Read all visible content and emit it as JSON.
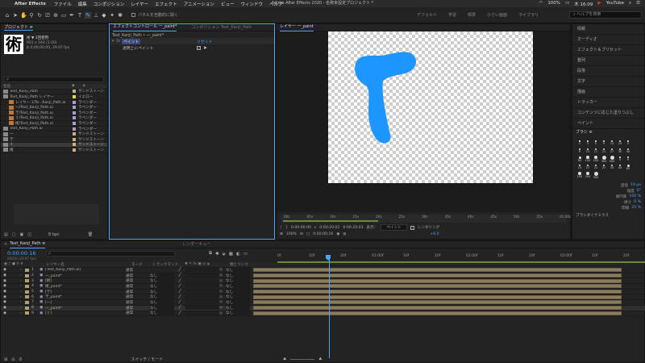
{
  "menubar": {
    "app": "After Effects",
    "items": [
      "ファイル",
      "編集",
      "コンポジション",
      "レイヤー",
      "エフェクト",
      "アニメーション",
      "ビュー",
      "ウィンドウ",
      "ヘルプ"
    ],
    "window_title": "Adobe After Effects 2020 - 名称未設定プロジェクト *",
    "battery": "100%",
    "clock": "木 16:09",
    "youtube": "YouTube"
  },
  "toolbar": {
    "auto_open_label": "パネルを自動的に開く",
    "workspaces": [
      "デフォルト",
      "学習",
      "標準",
      "小さい画面",
      "ライブラリ"
    ],
    "search_placeholder": "ヘルプを検索"
  },
  "project": {
    "tab": "プロジェクト ≡",
    "item_name": "術 ▼ 2回使用",
    "item_info1": "601 x 544 (1.00)",
    "item_info2": "Δ 0;00;00;00, 29.97 fps",
    "thumb_char": "術",
    "search_placeholder": "ρ",
    "col_name": "名前",
    "col_label": "種類",
    "rows": [
      {
        "name": "Text_Kanji_Path",
        "type": "サンドストーン",
        "color": "#c8b080",
        "indent": 0
      },
      {
        "name": "Text_Kanji_Path レイヤー",
        "type": "イエロー",
        "color": "#e6d84a",
        "indent": 0
      },
      {
        "name": "レイヤー 1/Te...Kanji_Path.ai",
        "type": "ラベンダー",
        "color": "#a89cd0",
        "indent": 1
      },
      {
        "name": "一/Text_Kanji_Path.ai",
        "type": "ラベンダー",
        "color": "#a89cd0",
        "indent": 1
      },
      {
        "name": "亍/Text_Kanji_Path.ai",
        "type": "ラベンダー",
        "color": "#a89cd0",
        "indent": 1
      },
      {
        "name": "彳/Text_Kanji_Path.ai",
        "type": "ラベンダー",
        "color": "#a89cd0",
        "indent": 1
      },
      {
        "name": "術/Text_Kanji_Path.ai",
        "type": "ラベンダー",
        "color": "#a89cd0",
        "indent": 1
      },
      {
        "name": "Text_Kanji_Path.ai",
        "type": "ラベンダー",
        "color": "#a89cd0",
        "indent": 0
      },
      {
        "name": "一",
        "type": "サンドストーン",
        "color": "#c8b080",
        "indent": 0
      },
      {
        "name": "亍",
        "type": "サンドストーン",
        "color": "#c8b080",
        "indent": 0
      },
      {
        "name": "彳",
        "type": "サンドストーン",
        "color": "#c8b080",
        "indent": 0
      },
      {
        "name": "術",
        "type": "サンドストーン",
        "color": "#c8b080",
        "indent": 0
      }
    ],
    "bpc": "8 bpc"
  },
  "effects": {
    "tab": "エフェクトコントロール 一_paint*",
    "tab_inactive": "コンポジション Text_Kanji_Path",
    "breadcrumb": "Text_Kanji_Path • 一_paint*",
    "effect_name": "ペイント",
    "reset": "リセット",
    "prop_label": "透明上にペイント"
  },
  "viewer": {
    "tab": "レイヤー 一_paint",
    "ruler_labels": [
      "00s",
      "05s",
      "10s",
      "15s",
      "20s",
      "25s",
      "30s",
      "35s",
      "40s",
      "45s",
      "50s",
      "55s",
      "01:00s"
    ],
    "zoom": "100%",
    "time1": "0:00:00:16",
    "time2": "0:00:00:00",
    "time3": "0:00:20:02",
    "time4": "0:00:20:03",
    "display_label": "表示：",
    "display_value": "ペイント",
    "render_label": "レンダリング",
    "exposure": "+0.0"
  },
  "right_panel": {
    "items": [
      "情報",
      "オーディオ",
      "エフェクト＆プリセット",
      "整列",
      "段落",
      "文字",
      "描画",
      "トラッカー",
      "コンテンツに応じた塗りつぶし",
      "ペイント"
    ],
    "brush_title": "ブラシ ≡",
    "brush_sizes": [
      "1",
      "3",
      "5",
      "9",
      "13",
      "19",
      "5",
      "9",
      "13",
      "17",
      "21",
      "27",
      "35",
      "45",
      "65",
      "100",
      "200",
      "300",
      "500",
      "5",
      "9",
      "13",
      "17",
      "21",
      "27",
      "35",
      "45",
      "65",
      "100",
      "200",
      "300"
    ],
    "params": [
      {
        "label": "直径",
        "value": "19 px"
      },
      {
        "label": "角度",
        "value": "0°"
      },
      {
        "label": "真円率",
        "value": "100 %"
      },
      {
        "label": "硬さ",
        "value": "0 %"
      },
      {
        "label": "間隔",
        "value": "25 %"
      }
    ],
    "dynamics": "ブラシダイナミクス"
  },
  "timeline": {
    "tab": "Text_Kanji_Path ≡",
    "render_queue": "レンダーキュー",
    "current_time": "0:00:00:16",
    "frame_info": "00016 (29.97 fps)",
    "col_layer": "レイヤー名",
    "col_mode": "モード",
    "col_trkmat": "トラックマット",
    "col_parent": "親とリンク",
    "ruler": [
      "0f",
      "10f",
      "20f",
      "01:00f",
      "10f",
      "20f",
      "02:00f",
      "10f",
      "20f",
      "03:00f",
      "10f",
      "20f"
    ],
    "layers": [
      {
        "num": "1",
        "name": "[Text_Kanji_Path.ai]",
        "mode": "通常",
        "trk": "",
        "parent": "なし"
      },
      {
        "num": "2",
        "name": "一_paint*",
        "mode": "通常",
        "trk": "なし",
        "parent": "なし"
      },
      {
        "num": "3",
        "name": "[術]",
        "mode": "通常",
        "trk": "なし",
        "parent": "なし"
      },
      {
        "num": "4",
        "name": "術_paint*",
        "mode": "通常",
        "trk": "なし",
        "parent": "なし"
      },
      {
        "num": "5",
        "name": "[亍]",
        "mode": "通常",
        "trk": "なし",
        "parent": "なし"
      },
      {
        "num": "6",
        "name": "亍_paint*",
        "mode": "通常",
        "trk": "なし",
        "parent": "なし"
      },
      {
        "num": "7",
        "name": "[一]",
        "mode": "通常",
        "trk": "なし",
        "parent": "なし"
      },
      {
        "num": "8",
        "name": "一_paint*",
        "mode": "通常",
        "trk": "なし",
        "parent": "なし"
      },
      {
        "num": "9",
        "name": "[彳]",
        "mode": "通常",
        "trk": "なし",
        "parent": "なし"
      }
    ],
    "toggle_label": "スイッチ / モード"
  },
  "colors": {
    "accent": "#4aa3ff",
    "paint": "#1e96ff",
    "layer_bar": "#8a7c5e",
    "work_area": "#6a8a3a"
  }
}
